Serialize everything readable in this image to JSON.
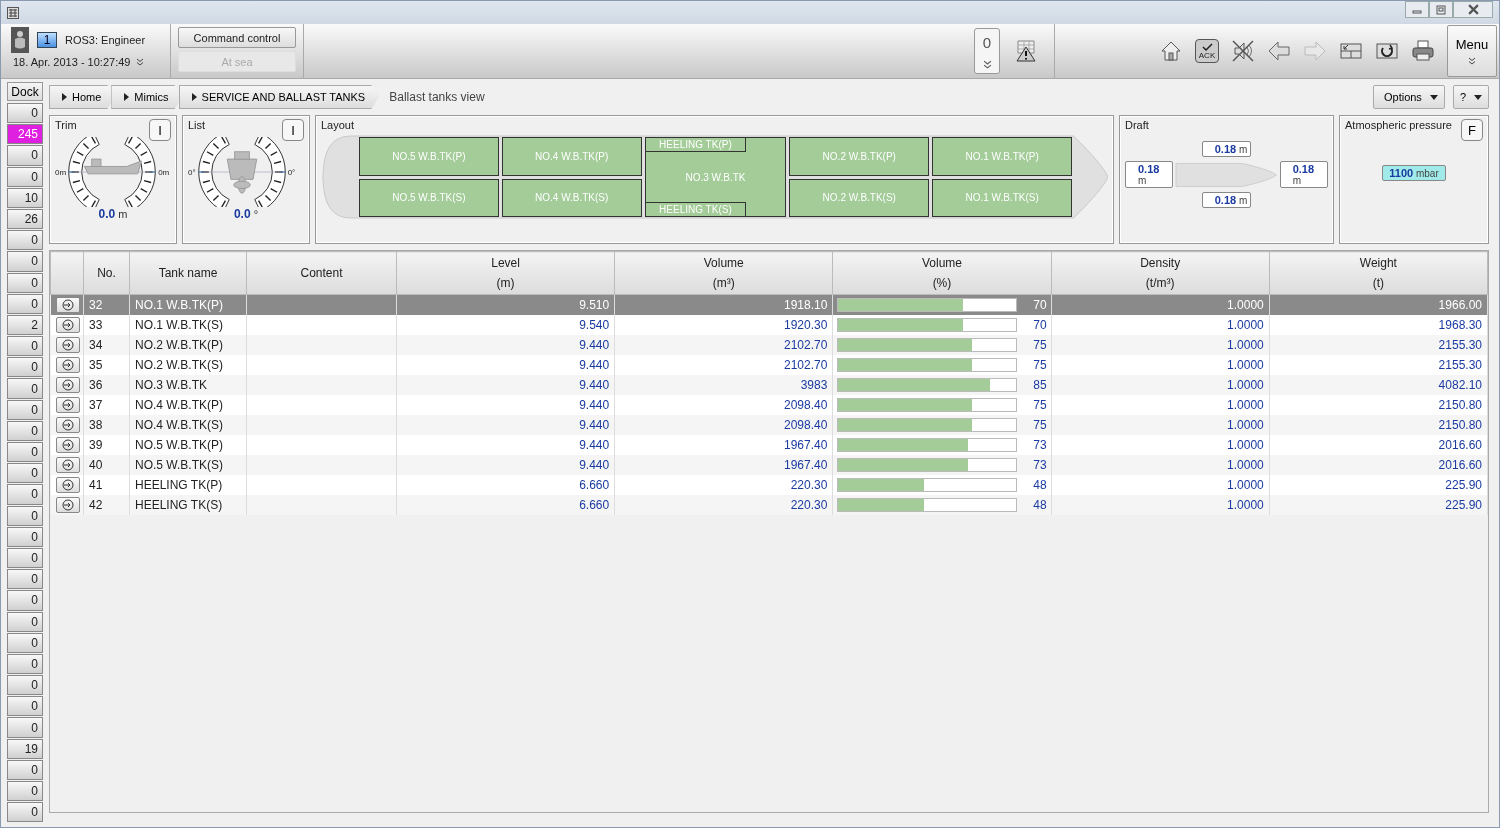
{
  "header": {
    "station_number": "1",
    "station": "ROS3: Engineer",
    "datetime": "18. Apr. 2013 - 10:27:49",
    "command_button": "Command control",
    "mode_button": "At sea",
    "alarm_count": "0",
    "ack_label": "ACK",
    "menu_button": "Menu"
  },
  "sidebar": {
    "dock_button": "Dock",
    "counters": [
      {
        "value": "0",
        "alarm": false
      },
      {
        "value": "245",
        "alarm": true
      },
      {
        "value": "0",
        "alarm": false
      },
      {
        "value": "0",
        "alarm": false
      },
      {
        "value": "10",
        "alarm": false
      },
      {
        "value": "26",
        "alarm": false
      },
      {
        "value": "0",
        "alarm": false
      },
      {
        "value": "0",
        "alarm": false
      },
      {
        "value": "0",
        "alarm": false
      },
      {
        "value": "0",
        "alarm": false
      },
      {
        "value": "2",
        "alarm": false
      },
      {
        "value": "0",
        "alarm": false
      },
      {
        "value": "0",
        "alarm": false
      },
      {
        "value": "0",
        "alarm": false
      },
      {
        "value": "0",
        "alarm": false
      },
      {
        "value": "0",
        "alarm": false
      },
      {
        "value": "0",
        "alarm": false
      },
      {
        "value": "0",
        "alarm": false
      },
      {
        "value": "0",
        "alarm": false
      },
      {
        "value": "0",
        "alarm": false
      },
      {
        "value": "0",
        "alarm": false
      },
      {
        "value": "0",
        "alarm": false
      },
      {
        "value": "0",
        "alarm": false
      },
      {
        "value": "0",
        "alarm": false
      },
      {
        "value": "0",
        "alarm": false
      },
      {
        "value": "0",
        "alarm": false
      },
      {
        "value": "0",
        "alarm": false
      },
      {
        "value": "0",
        "alarm": false
      },
      {
        "value": "0",
        "alarm": false
      },
      {
        "value": "0",
        "alarm": false
      },
      {
        "value": "19",
        "alarm": false
      },
      {
        "value": "0",
        "alarm": false
      },
      {
        "value": "0",
        "alarm": false
      },
      {
        "value": "0",
        "alarm": false
      }
    ]
  },
  "breadcrumb": {
    "items": [
      "Home",
      "Mimics",
      "SERVICE AND BALLAST TANKS"
    ],
    "current": "Ballast tanks view"
  },
  "options_button": "Options",
  "help_button": "?",
  "trim": {
    "title": "Trim",
    "mode_button": "I",
    "left_label": "0m",
    "right_label": "0m",
    "value": "0.0",
    "unit": "m"
  },
  "list": {
    "title": "List",
    "mode_button": "I",
    "left_label": "0°",
    "right_label": "0°",
    "value": "0.0",
    "unit": "°"
  },
  "layout": {
    "title": "Layout",
    "columns": [
      {
        "kind": "pair",
        "port": "NO.5 W.B.TK(P)",
        "starboard": "NO.5 W.B.TK(S)"
      },
      {
        "kind": "pair",
        "port": "NO.4 W.B.TK(P)",
        "starboard": "NO.4 W.B.TK(S)"
      },
      {
        "kind": "center",
        "port": "HEELING TK(P)",
        "middle": "NO.3 W.B.TK",
        "starboard": "HEELING TK(S)"
      },
      {
        "kind": "pair",
        "port": "NO.2 W.B.TK(P)",
        "starboard": "NO.2 W.B.TK(S)"
      },
      {
        "kind": "pair",
        "port": "NO.1 W.B.TK(P)",
        "starboard": "NO.1 W.B.TK(S)"
      }
    ]
  },
  "draft": {
    "title": "Draft",
    "port": {
      "value": "0.18",
      "unit": "m"
    },
    "aft": {
      "value": "0.18",
      "unit": "m"
    },
    "fore": {
      "value": "0.18",
      "unit": "m"
    },
    "starboard": {
      "value": "0.18",
      "unit": "m"
    }
  },
  "pressure": {
    "title": "Atmospheric pressure",
    "mode_button": "F",
    "value": "1100",
    "unit": "mbar"
  },
  "table": {
    "columns": [
      {
        "label": "No."
      },
      {
        "label": "Tank name"
      },
      {
        "label": "Content"
      },
      {
        "label": "Level",
        "unit": "(m)"
      },
      {
        "label": "Volume",
        "unit": "(m³)"
      },
      {
        "label": "Volume",
        "unit": "(%)"
      },
      {
        "label": "Density",
        "unit": "(t/m³)"
      },
      {
        "label": "Weight",
        "unit": "(t)"
      }
    ],
    "rows": [
      {
        "no": "32",
        "name": "NO.1 W.B.TK(P)",
        "level_m": "9.510",
        "volume": "1918.10",
        "level": 0.7,
        "percent": "70",
        "density": "1.0000",
        "weight": "1966.00",
        "selected": true
      },
      {
        "no": "33",
        "name": "NO.1 W.B.TK(S)",
        "level_m": "9.540",
        "volume": "1920.30",
        "level": 0.7,
        "percent": "70",
        "density": "1.0000",
        "weight": "1968.30",
        "selected": false
      },
      {
        "no": "34",
        "name": "NO.2 W.B.TK(P)",
        "level_m": "9.440",
        "volume": "2102.70",
        "level": 0.75,
        "percent": "75",
        "density": "1.0000",
        "weight": "2155.30",
        "selected": false
      },
      {
        "no": "35",
        "name": "NO.2 W.B.TK(S)",
        "level_m": "9.440",
        "volume": "2102.70",
        "level": 0.75,
        "percent": "75",
        "density": "1.0000",
        "weight": "2155.30",
        "selected": false
      },
      {
        "no": "36",
        "name": "NO.3 W.B.TK",
        "level_m": "9.440",
        "volume": "3983",
        "level": 0.85,
        "percent": "85",
        "density": "1.0000",
        "weight": "4082.10",
        "selected": false
      },
      {
        "no": "37",
        "name": "NO.4 W.B.TK(P)",
        "level_m": "9.440",
        "volume": "2098.40",
        "level": 0.75,
        "percent": "75",
        "density": "1.0000",
        "weight": "2150.80",
        "selected": false
      },
      {
        "no": "38",
        "name": "NO.4 W.B.TK(S)",
        "level_m": "9.440",
        "volume": "2098.40",
        "level": 0.75,
        "percent": "75",
        "density": "1.0000",
        "weight": "2150.80",
        "selected": false
      },
      {
        "no": "39",
        "name": "NO.5 W.B.TK(P)",
        "level_m": "9.440",
        "volume": "1967.40",
        "level": 0.73,
        "percent": "73",
        "density": "1.0000",
        "weight": "2016.60",
        "selected": false
      },
      {
        "no": "40",
        "name": "NO.5 W.B.TK(S)",
        "level_m": "9.440",
        "volume": "1967.40",
        "level": 0.73,
        "percent": "73",
        "density": "1.0000",
        "weight": "2016.60",
        "selected": false
      },
      {
        "no": "41",
        "name": "HEELING TK(P)",
        "level_m": "6.660",
        "volume": "220.30",
        "level": 0.48,
        "percent": "48",
        "density": "1.0000",
        "weight": "225.90",
        "selected": false
      },
      {
        "no": "42",
        "name": "HEELING TK(S)",
        "level_m": "6.660",
        "volume": "220.30",
        "level": 0.48,
        "percent": "48",
        "density": "1.0000",
        "weight": "225.90",
        "selected": false
      }
    ]
  }
}
